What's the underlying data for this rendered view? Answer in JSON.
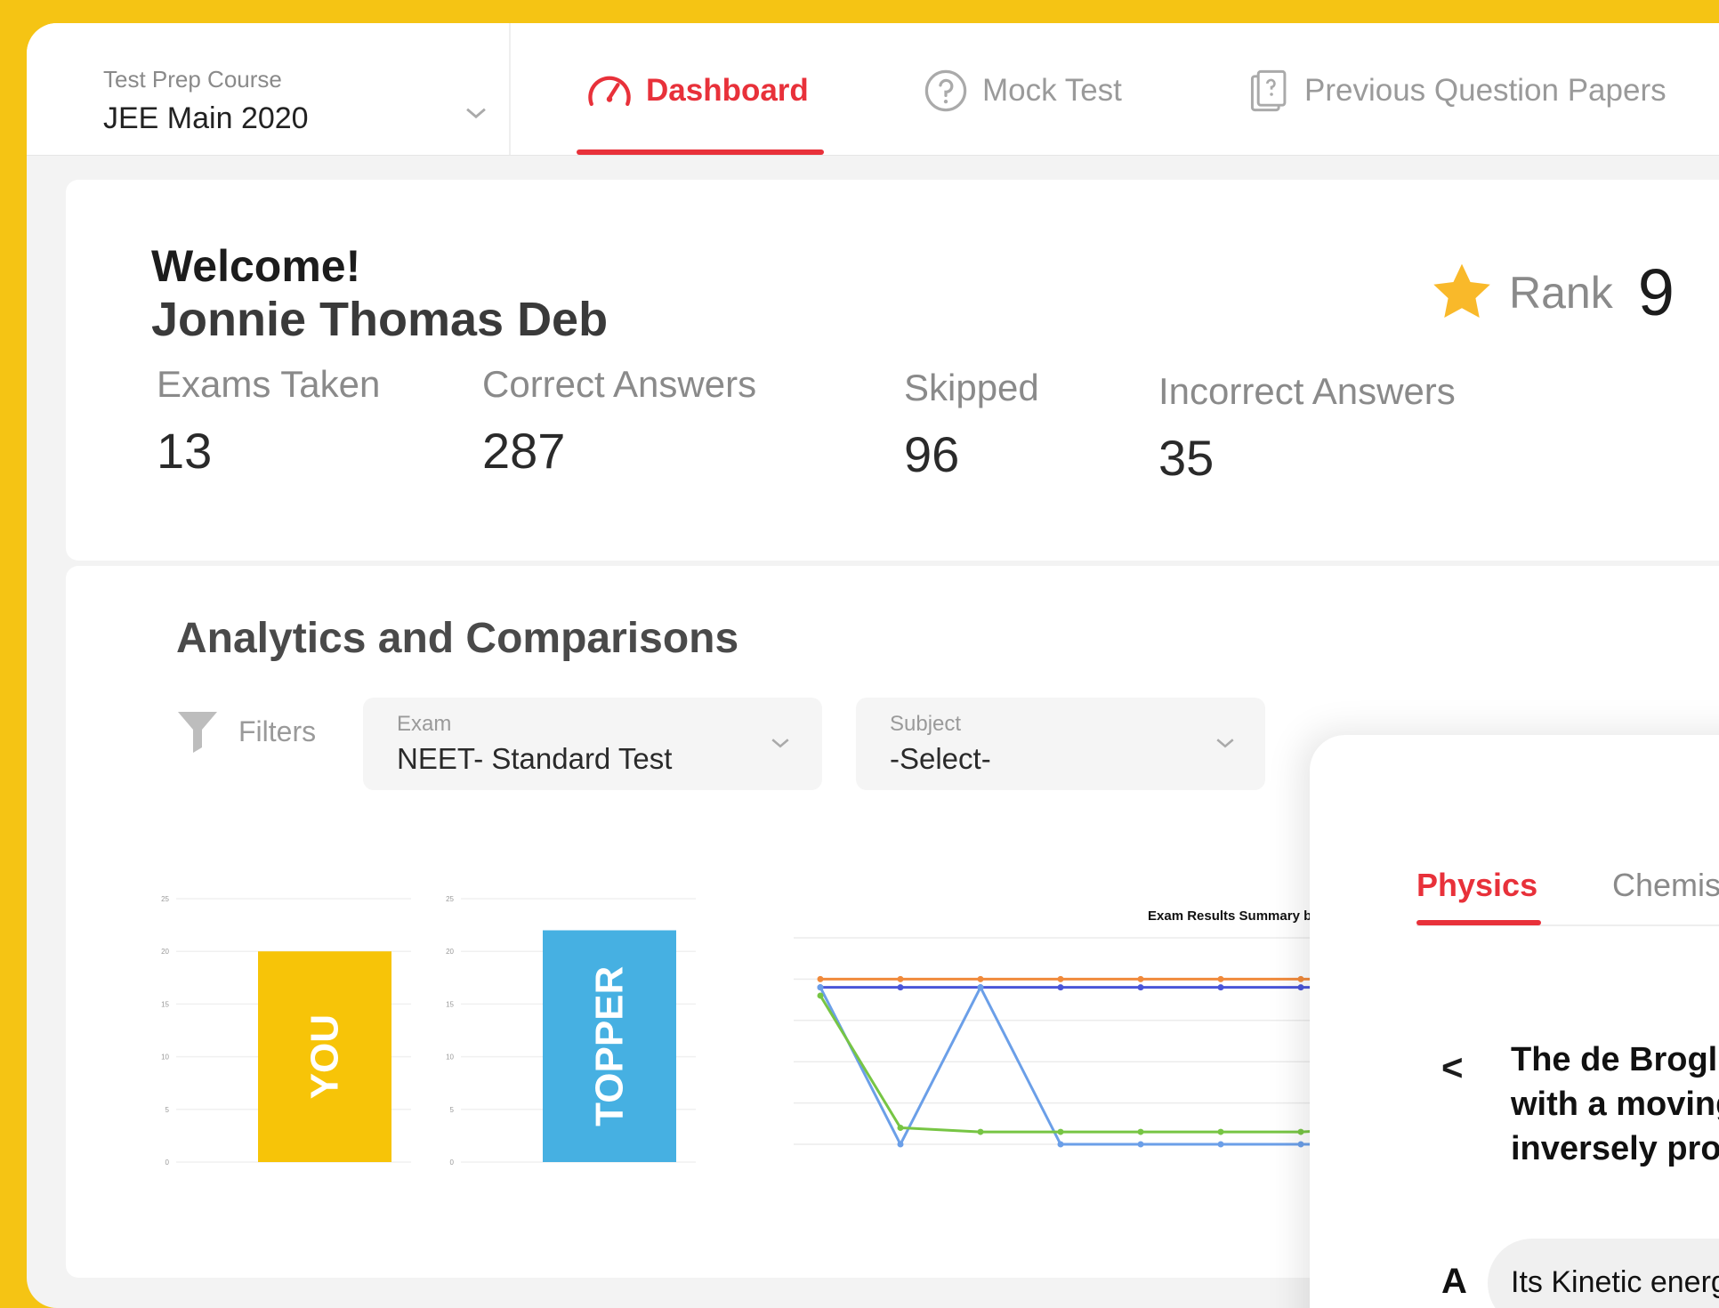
{
  "colors": {
    "brand_yellow": "#f5c414",
    "accent_red": "#e8313a",
    "you_bar": "#f7c408",
    "topper_bar": "#46b0e2",
    "series_orange": "#f08a3c",
    "series_darkblue": "#4a55d8",
    "series_lightblue": "#6b9fe8",
    "series_green": "#77c544"
  },
  "course": {
    "label": "Test Prep Course",
    "value": "JEE Main 2020",
    "icon": "chevron-down-icon"
  },
  "nav": [
    {
      "label": "Dashboard",
      "icon": "speedometer-icon",
      "active": true
    },
    {
      "label": "Mock Test",
      "icon": "question-circle-icon",
      "active": false
    },
    {
      "label": "Previous Question Papers",
      "icon": "question-paper-icon",
      "active": false
    }
  ],
  "welcome": {
    "greeting": "Welcome!",
    "name": "Jonnie Thomas Deb"
  },
  "rank": {
    "label": "Rank",
    "value": "9",
    "icon": "star-icon"
  },
  "stats": [
    {
      "label": "Exams Taken",
      "value": "13"
    },
    {
      "label": "Correct Answers",
      "value": "287"
    },
    {
      "label": "Skipped",
      "value": "96"
    },
    {
      "label": "Incorrect Answers",
      "value": "35"
    }
  ],
  "analytics": {
    "title": "Analytics and Comparisons",
    "filters_label": "Filters",
    "exam_select": {
      "label": "Exam",
      "value": "NEET- Standard Test"
    },
    "subject_select": {
      "label": "Subject",
      "value": "-Select-"
    }
  },
  "chart_data": [
    {
      "type": "bar",
      "categories": [
        "YOU"
      ],
      "values": [
        20
      ],
      "ylim": [
        0,
        25
      ],
      "yticks": [
        "0",
        "5",
        "10",
        "15",
        "20",
        "25"
      ]
    },
    {
      "type": "bar",
      "categories": [
        "TOPPER"
      ],
      "values": [
        22
      ],
      "ylim": [
        0,
        25
      ],
      "yticks": [
        "0",
        "5",
        "10",
        "15",
        "20",
        "25"
      ]
    },
    {
      "type": "line",
      "title": "Exam Results Summary by",
      "ylim": [
        0,
        2.5
      ],
      "x": [
        1,
        2,
        3,
        4,
        5,
        6,
        7,
        8
      ],
      "series": [
        {
          "values": [
            2.0,
            2.0,
            2.0,
            2.0,
            2.0,
            2.0,
            2.0,
            2.0
          ]
        },
        {
          "values": [
            1.9,
            1.9,
            1.9,
            1.9,
            1.9,
            1.9,
            1.9,
            1.9
          ]
        },
        {
          "values": [
            1.9,
            0.0,
            1.9,
            0.0,
            0.0,
            0.0,
            0.0,
            0.0
          ]
        },
        {
          "values": [
            1.8,
            0.2,
            0.15,
            0.15,
            0.15,
            0.15,
            0.15,
            0.2
          ]
        }
      ]
    }
  ],
  "question_panel": {
    "tabs": [
      "Physics",
      "Chemistr"
    ],
    "prev": "<",
    "question_lines": [
      "The de Broglie",
      "with a moving",
      "inversely prop"
    ],
    "option_letter": "A",
    "option_text": "Its Kinetic energ"
  }
}
